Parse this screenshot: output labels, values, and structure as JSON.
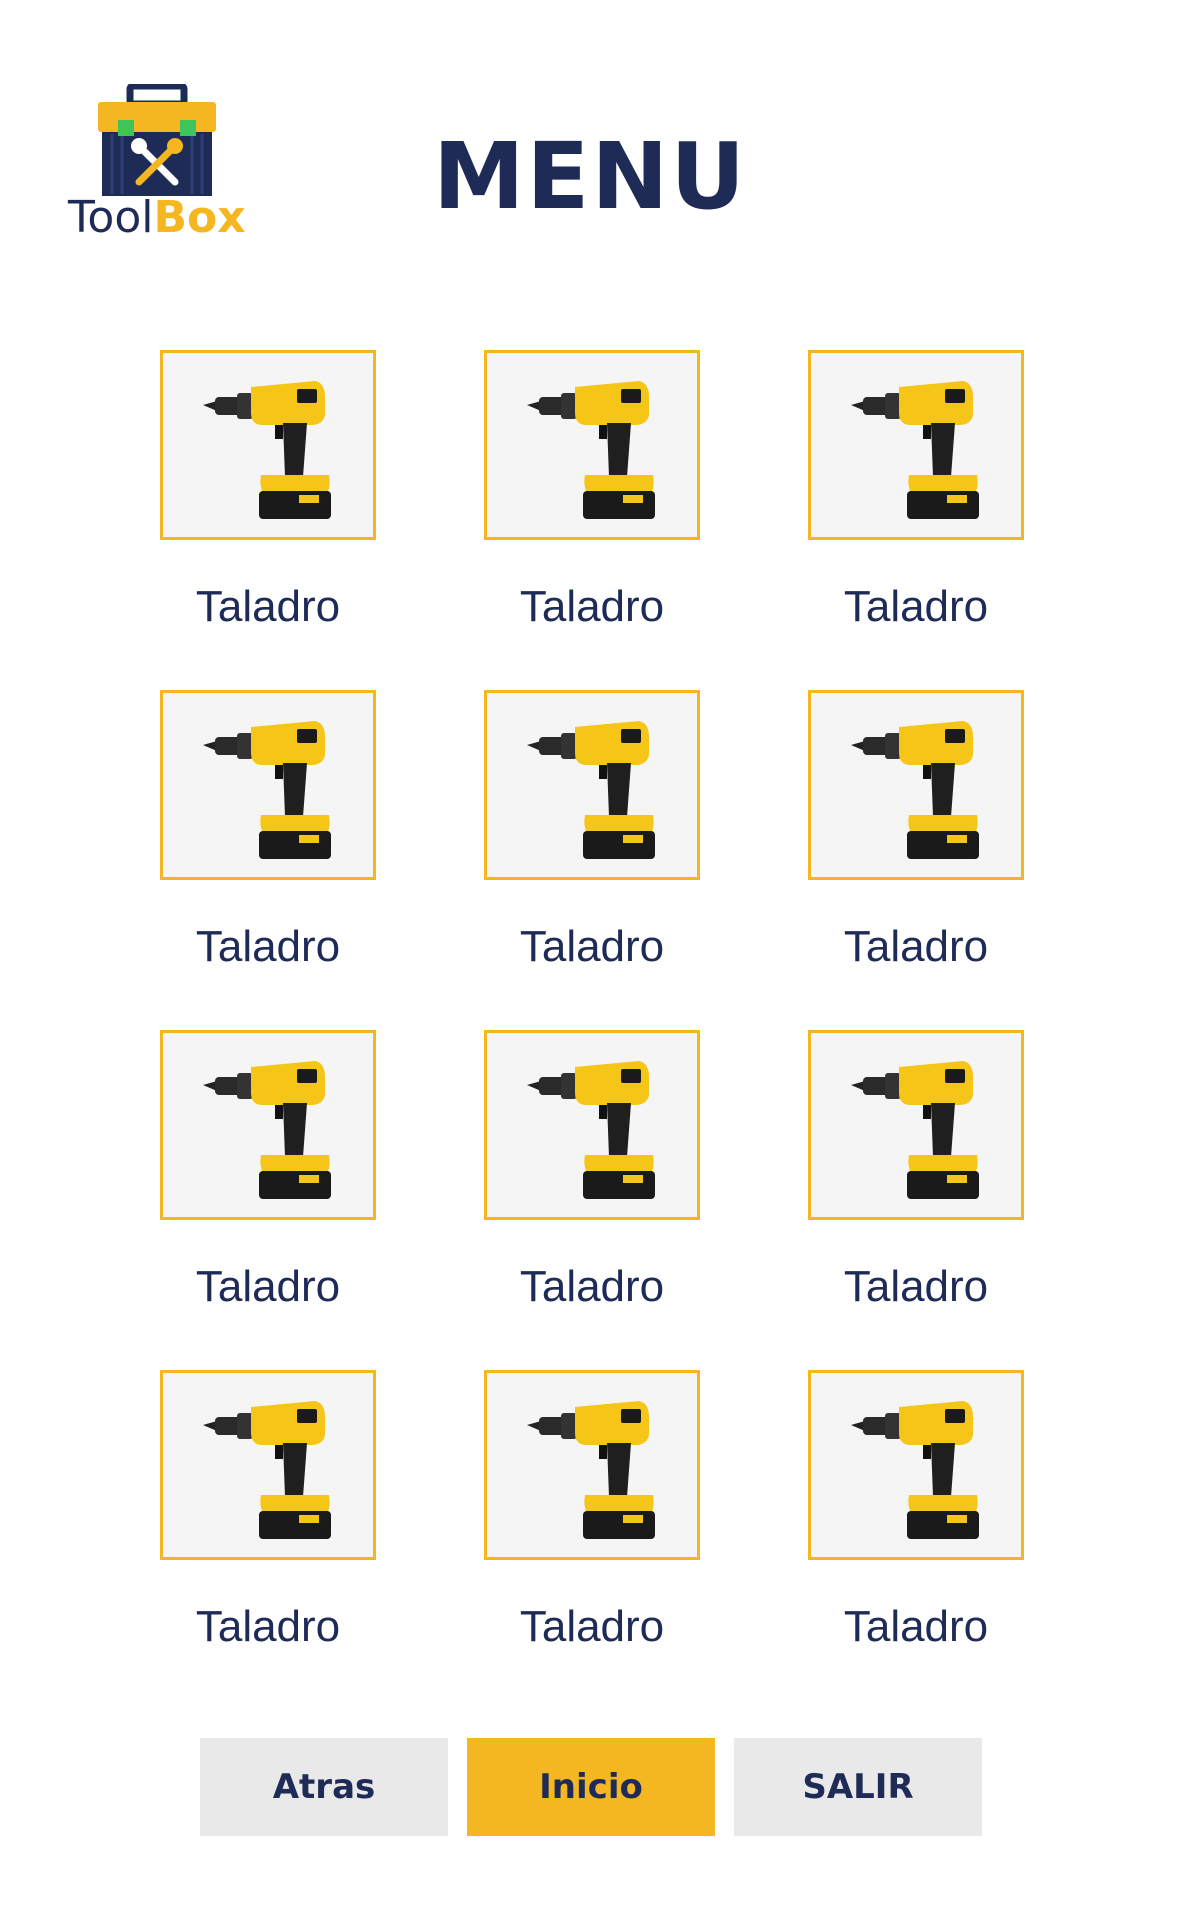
{
  "header": {
    "logo_word_1": "Tool",
    "logo_word_2": "Box",
    "title": "MENU"
  },
  "tools": [
    {
      "label": "Taladro",
      "icon": "drill-icon"
    },
    {
      "label": "Taladro",
      "icon": "drill-icon"
    },
    {
      "label": "Taladro",
      "icon": "drill-icon"
    },
    {
      "label": "Taladro",
      "icon": "drill-icon"
    },
    {
      "label": "Taladro",
      "icon": "drill-icon"
    },
    {
      "label": "Taladro",
      "icon": "drill-icon"
    },
    {
      "label": "Taladro",
      "icon": "drill-icon"
    },
    {
      "label": "Taladro",
      "icon": "drill-icon"
    },
    {
      "label": "Taladro",
      "icon": "drill-icon"
    },
    {
      "label": "Taladro",
      "icon": "drill-icon"
    },
    {
      "label": "Taladro",
      "icon": "drill-icon"
    },
    {
      "label": "Taladro",
      "icon": "drill-icon"
    }
  ],
  "footer": {
    "back_label": "Atras",
    "home_label": "Inicio",
    "exit_label": "SALIR"
  },
  "colors": {
    "primary": "#1e2b57",
    "accent": "#f5b721",
    "button_bg": "#e9e9e9",
    "tile_bg": "#f5f5f5"
  }
}
